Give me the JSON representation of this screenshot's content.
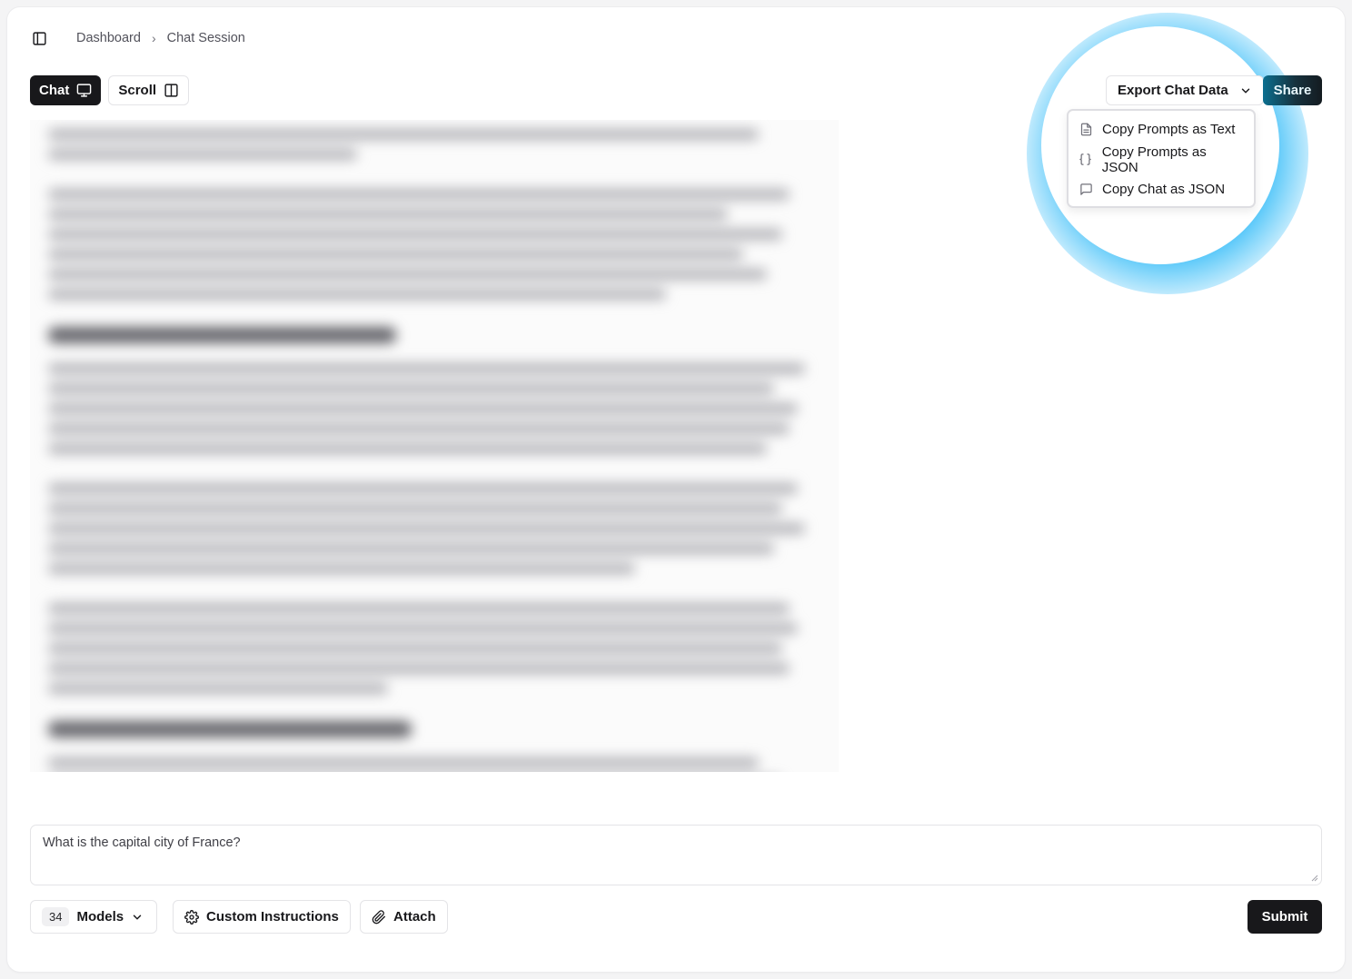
{
  "header": {
    "breadcrumb": [
      "Dashboard",
      "Chat Session"
    ],
    "separator": "›"
  },
  "view_toggle": {
    "chat_label": "Chat",
    "scroll_label": "Scroll"
  },
  "export": {
    "button_label": "Export Chat Data",
    "menu_items": [
      {
        "label": "Copy Prompts as Text",
        "icon": "file-text-icon"
      },
      {
        "label": "Copy Prompts as JSON",
        "icon": "braces-icon"
      },
      {
        "label": "Copy Chat as JSON",
        "icon": "message-square-icon"
      }
    ]
  },
  "share": {
    "label": "Share"
  },
  "prompt": {
    "value": "What is the capital city of France?"
  },
  "toolbar": {
    "models_count": "34",
    "models_label": "Models",
    "custom_instructions_label": "Custom Instructions",
    "attach_label": "Attach",
    "submit_label": "Submit"
  },
  "colors": {
    "primary": "#18181b",
    "highlight_glow": "#38bdf8",
    "border": "#e4e4e7"
  }
}
